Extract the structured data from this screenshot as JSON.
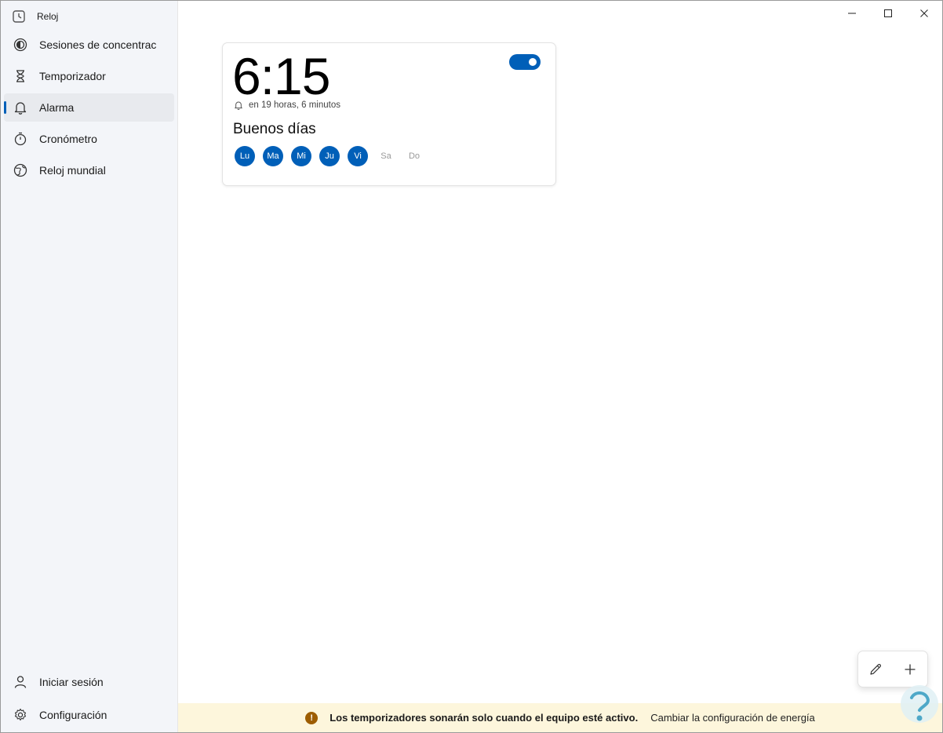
{
  "app": {
    "title": "Reloj"
  },
  "sidebar": {
    "items": [
      {
        "label": "Sesiones de concentración",
        "icon": "focus-icon"
      },
      {
        "label": "Temporizador",
        "icon": "hourglass-icon"
      },
      {
        "label": "Alarma",
        "icon": "bell-icon",
        "active": true
      },
      {
        "label": "Cronómetro",
        "icon": "stopwatch-icon"
      },
      {
        "label": "Reloj mundial",
        "icon": "globe-icon"
      }
    ],
    "bottom": [
      {
        "label": "Iniciar sesión",
        "icon": "person-icon"
      },
      {
        "label": "Configuración",
        "icon": "gear-icon"
      }
    ]
  },
  "alarm": {
    "time": "6:15",
    "enabled": true,
    "remaining": "en 19 horas, 6 minutos",
    "name": "Buenos días",
    "days": [
      {
        "label": "Lu",
        "on": true
      },
      {
        "label": "Ma",
        "on": true
      },
      {
        "label": "Mi",
        "on": true
      },
      {
        "label": "Ju",
        "on": true
      },
      {
        "label": "Vi",
        "on": true
      },
      {
        "label": "Sa",
        "on": false
      },
      {
        "label": "Do",
        "on": false
      }
    ]
  },
  "infobar": {
    "message": "Los temporizadores sonarán solo cuando el equipo esté activo.",
    "link": "Cambiar la configuración de energía"
  },
  "colors": {
    "accent": "#005fb8",
    "infobar_bg": "#fdf6dc",
    "warning": "#9d5d00"
  }
}
